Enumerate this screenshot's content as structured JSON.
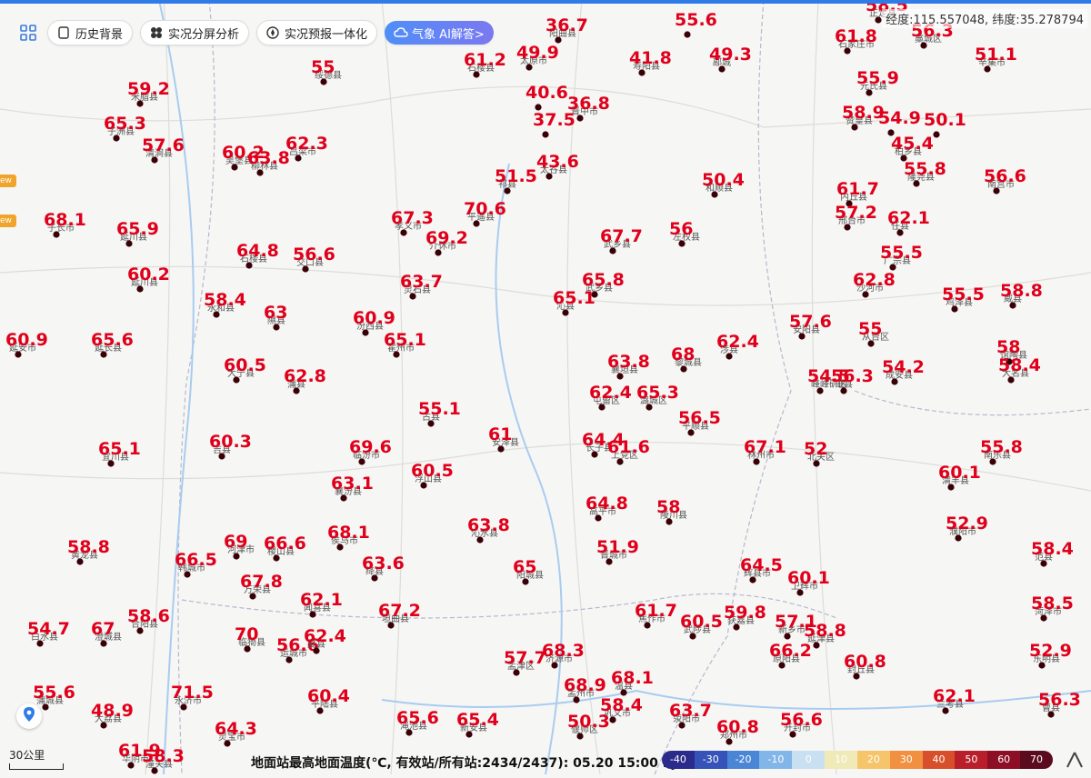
{
  "toolbar": {
    "history": "历史背景",
    "split": "实况分屏分析",
    "forecast": "实况预报一体化",
    "ai": "气象 AI解答>"
  },
  "coords_text": "经度:115.557048, 纬度:35.278794",
  "badge_text": "ew",
  "scale_label": "30公里",
  "status_text": "地面站最高地面温度(℃, 有效站/所有站:2434/2437): 05.20 15:00 BJT",
  "legend_ticks": [
    "-40",
    "-30",
    "-20",
    "-10",
    "0",
    "10",
    "20",
    "30",
    "40",
    "50",
    "60",
    "70"
  ],
  "legend_colors": [
    "#2b2b8c",
    "#3553b8",
    "#4b86d6",
    "#82b6e8",
    "#c9e0f2",
    "#f0e9b8",
    "#f6c46b",
    "#f09040",
    "#d8502b",
    "#b81f2a",
    "#8c0f25",
    "#5a0c1e"
  ],
  "value_color": "#e0001b",
  "stations": [
    {
      "v": "36.7",
      "n": "阳曲县"
    },
    {
      "v": "55.6",
      "n": ""
    },
    {
      "v": "58.5",
      "n": "正定县"
    },
    {
      "v": "49.9",
      "n": "太原市"
    },
    {
      "v": "41.8",
      "n": "寿阳县"
    },
    {
      "v": "49.3",
      "n": "鄗城"
    },
    {
      "v": "59.2",
      "n": "米脂县"
    },
    {
      "v": "55",
      "n": "绥德县"
    },
    {
      "v": "61.2",
      "n": "石楼县"
    },
    {
      "v": "40.6",
      "n": ""
    },
    {
      "v": "36.8",
      "n": "晋中市"
    },
    {
      "v": "37.5",
      "n": ""
    },
    {
      "v": "65.3",
      "n": "子洲县"
    },
    {
      "v": "57.6",
      "n": "清涧县"
    },
    {
      "v": "60.2",
      "n": "吴堡县"
    },
    {
      "v": "63.8",
      "n": "柳林县"
    },
    {
      "v": "62.3",
      "n": "吕梁市"
    },
    {
      "v": "43.6",
      "n": "太谷县"
    },
    {
      "v": "51.5",
      "n": "祁县"
    },
    {
      "v": "50.4",
      "n": "和顺县"
    },
    {
      "v": "61.8",
      "n": "石家庄市"
    },
    {
      "v": "56.3",
      "n": "藁城区"
    },
    {
      "v": "51.1",
      "n": "辛集市"
    },
    {
      "v": "55.9",
      "n": "元氏县"
    },
    {
      "v": "58.9",
      "n": "赞皇县"
    },
    {
      "v": "54.9",
      "n": ""
    },
    {
      "v": "45.4",
      "n": "柏乡县"
    },
    {
      "v": "50.1",
      "n": ""
    },
    {
      "v": "55.8",
      "n": "隆尧县"
    },
    {
      "v": "56.6",
      "n": "南宫市"
    },
    {
      "v": "68.1",
      "n": "子长市"
    },
    {
      "v": "65.9",
      "n": "延川县"
    },
    {
      "v": "64.8",
      "n": "石楼县"
    },
    {
      "v": "56.6",
      "n": "交口县"
    },
    {
      "v": "67.3",
      "n": "孝义市"
    },
    {
      "v": "69.2",
      "n": "介休市"
    },
    {
      "v": "70.6",
      "n": "平遥县"
    },
    {
      "v": "67.7",
      "n": "武乡县"
    },
    {
      "v": "56",
      "n": "左权县"
    },
    {
      "v": "61.7",
      "n": "内丘县"
    },
    {
      "v": "57.2",
      "n": "邢台市"
    },
    {
      "v": "62.1",
      "n": "任县"
    },
    {
      "v": "55.5",
      "n": "广宗县"
    },
    {
      "v": "60.2",
      "n": "延川县"
    },
    {
      "v": "58.4",
      "n": "永和县"
    },
    {
      "v": "63",
      "n": "隰县"
    },
    {
      "v": "63.7",
      "n": "灵石县"
    },
    {
      "v": "65.8",
      "n": "武乡县"
    },
    {
      "v": "65.1",
      "n": "沁县"
    },
    {
      "v": "62.8",
      "n": "沙河市"
    },
    {
      "v": "55.5",
      "n": "鸡泽县"
    },
    {
      "v": "58.8",
      "n": "威县"
    },
    {
      "v": "60.9",
      "n": "延安市"
    },
    {
      "v": "65.6",
      "n": "延长县"
    },
    {
      "v": "60.9",
      "n": "汾西县"
    },
    {
      "v": "65.1",
      "n": "霍州市"
    },
    {
      "v": "60.5",
      "n": "大宁县"
    },
    {
      "v": "62.8",
      "n": "蒲县"
    },
    {
      "v": "68",
      "n": "黎城县"
    },
    {
      "v": "62.4",
      "n": "涉县"
    },
    {
      "v": "57.6",
      "n": "安阳县"
    },
    {
      "v": "55",
      "n": "从台区"
    },
    {
      "v": "54.2",
      "n": "成安县"
    },
    {
      "v": "58",
      "n": "馆陶县"
    },
    {
      "v": "58.4",
      "n": "大名县"
    },
    {
      "v": "63.8",
      "n": "襄垣县"
    },
    {
      "v": "62.4",
      "n": "屯留区"
    },
    {
      "v": "65.3",
      "n": "潞城区"
    },
    {
      "v": "56.5",
      "n": "平顺县"
    },
    {
      "v": "54.5",
      "n": "峰峰矿区"
    },
    {
      "v": "56.3",
      "n": "磁县"
    },
    {
      "v": "65.1",
      "n": "宜川县"
    },
    {
      "v": "60.3",
      "n": "吉县"
    },
    {
      "v": "69.6",
      "n": "临汾市"
    },
    {
      "v": "55.1",
      "n": "古县"
    },
    {
      "v": "61",
      "n": "安泽县"
    },
    {
      "v": "64.4",
      "n": "长子县"
    },
    {
      "v": "61.6",
      "n": "上党区"
    },
    {
      "v": "67.1",
      "n": "林州市"
    },
    {
      "v": "52",
      "n": "北关区"
    },
    {
      "v": "55.8",
      "n": "南乐县"
    },
    {
      "v": "60.1",
      "n": "清丰县"
    },
    {
      "v": "63.1",
      "n": "襄汾县"
    },
    {
      "v": "60.5",
      "n": "浮山县"
    },
    {
      "v": "63.8",
      "n": "沁水县"
    },
    {
      "v": "64.8",
      "n": "高平市"
    },
    {
      "v": "58",
      "n": "陵川县"
    },
    {
      "v": "52.9",
      "n": "濮阳市"
    },
    {
      "v": "58.8",
      "n": "黄龙县"
    },
    {
      "v": "66.5",
      "n": "韩城市"
    },
    {
      "v": "69",
      "n": "河津市"
    },
    {
      "v": "66.6",
      "n": "稷山县"
    },
    {
      "v": "68.1",
      "n": "侯马市"
    },
    {
      "v": "63.6",
      "n": "绛县"
    },
    {
      "v": "65",
      "n": "阳城县"
    },
    {
      "v": "51.9",
      "n": "晋城市"
    },
    {
      "v": "64.5",
      "n": "辉县市"
    },
    {
      "v": "60.1",
      "n": "卫辉市"
    },
    {
      "v": "58.4",
      "n": "范县"
    },
    {
      "v": "58.6",
      "n": "合阳县"
    },
    {
      "v": "67.8",
      "n": "万荣县"
    },
    {
      "v": "62.1",
      "n": "闻喜县"
    },
    {
      "v": "67.2",
      "n": "垣曲县"
    },
    {
      "v": "61.7",
      "n": "焦作市"
    },
    {
      "v": "60.5",
      "n": "武陟县"
    },
    {
      "v": "59.8",
      "n": "获嘉县"
    },
    {
      "v": "57.1",
      "n": "新乡市"
    },
    {
      "v": "58.8",
      "n": "延津县"
    },
    {
      "v": "58.5",
      "n": "菏泽市"
    },
    {
      "v": "54.7",
      "n": "白水县"
    },
    {
      "v": "67",
      "n": "澄城县"
    },
    {
      "v": "70",
      "n": "临猗县"
    },
    {
      "v": "56.6",
      "n": "运城市"
    },
    {
      "v": "62.4",
      "n": "夏县"
    },
    {
      "v": "68.3",
      "n": "济源市"
    },
    {
      "v": "68.9",
      "n": "孟州市"
    },
    {
      "v": "68.1",
      "n": "温县"
    },
    {
      "v": "66.2",
      "n": "原阳县"
    },
    {
      "v": "60.8",
      "n": "封丘县"
    },
    {
      "v": "52.9",
      "n": "东明县"
    },
    {
      "v": "55.6",
      "n": "蒲城县"
    },
    {
      "v": "71.5",
      "n": "永济市"
    },
    {
      "v": "60.4",
      "n": "平陆县"
    },
    {
      "v": "48.9",
      "n": "大荔县"
    },
    {
      "v": "64.3",
      "n": "灵宝市"
    },
    {
      "v": "65.6",
      "n": "渑池县"
    },
    {
      "v": "65.4",
      "n": "新安县"
    },
    {
      "v": "50.3",
      "n": "偃师区"
    },
    {
      "v": "58.4",
      "n": "巩义市"
    },
    {
      "v": "63.7",
      "n": "荥阳市"
    },
    {
      "v": "60.8",
      "n": "郑州市"
    },
    {
      "v": "56.6",
      "n": "开封市"
    },
    {
      "v": "62.1",
      "n": "兰考县"
    },
    {
      "v": "56.3",
      "n": "曹县"
    },
    {
      "v": "61.9",
      "n": "华阴市"
    },
    {
      "v": "58.3",
      "n": "潼关县"
    },
    {
      "v": "57.7",
      "n": "孟津区"
    }
  ]
}
